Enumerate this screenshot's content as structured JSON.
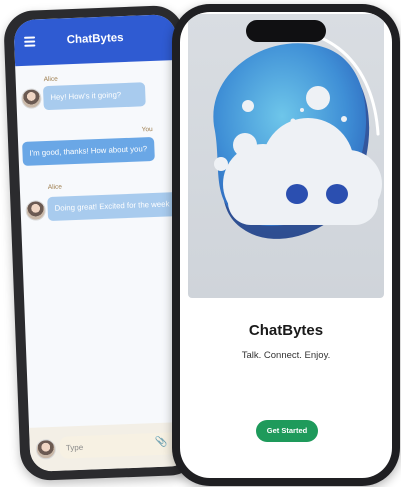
{
  "chat_app": {
    "title": "ChatBytes",
    "messages": [
      {
        "sender": "Alice",
        "text": "Hey! How's it going?",
        "direction": "in"
      },
      {
        "sender": "You",
        "text": "I'm good, thanks! How about you?",
        "direction": "out"
      },
      {
        "sender": "Alice",
        "text": "Doing great! Excited for the week",
        "direction": "in"
      }
    ],
    "input_placeholder": "Type"
  },
  "welcome": {
    "app_name": "ChatBytes",
    "tagline": "Talk. Connect. Enjoy.",
    "cta_label": "Get Started"
  },
  "colors": {
    "header_blue": "#2f5bd2",
    "bubble_in": "#a8cbee",
    "bubble_out": "#6aa7e6",
    "cta_green": "#1e9a5b"
  },
  "icons": {
    "menu": "hamburger-menu-icon",
    "attach": "paperclip-icon",
    "logo": "cloud-chat-logo"
  }
}
